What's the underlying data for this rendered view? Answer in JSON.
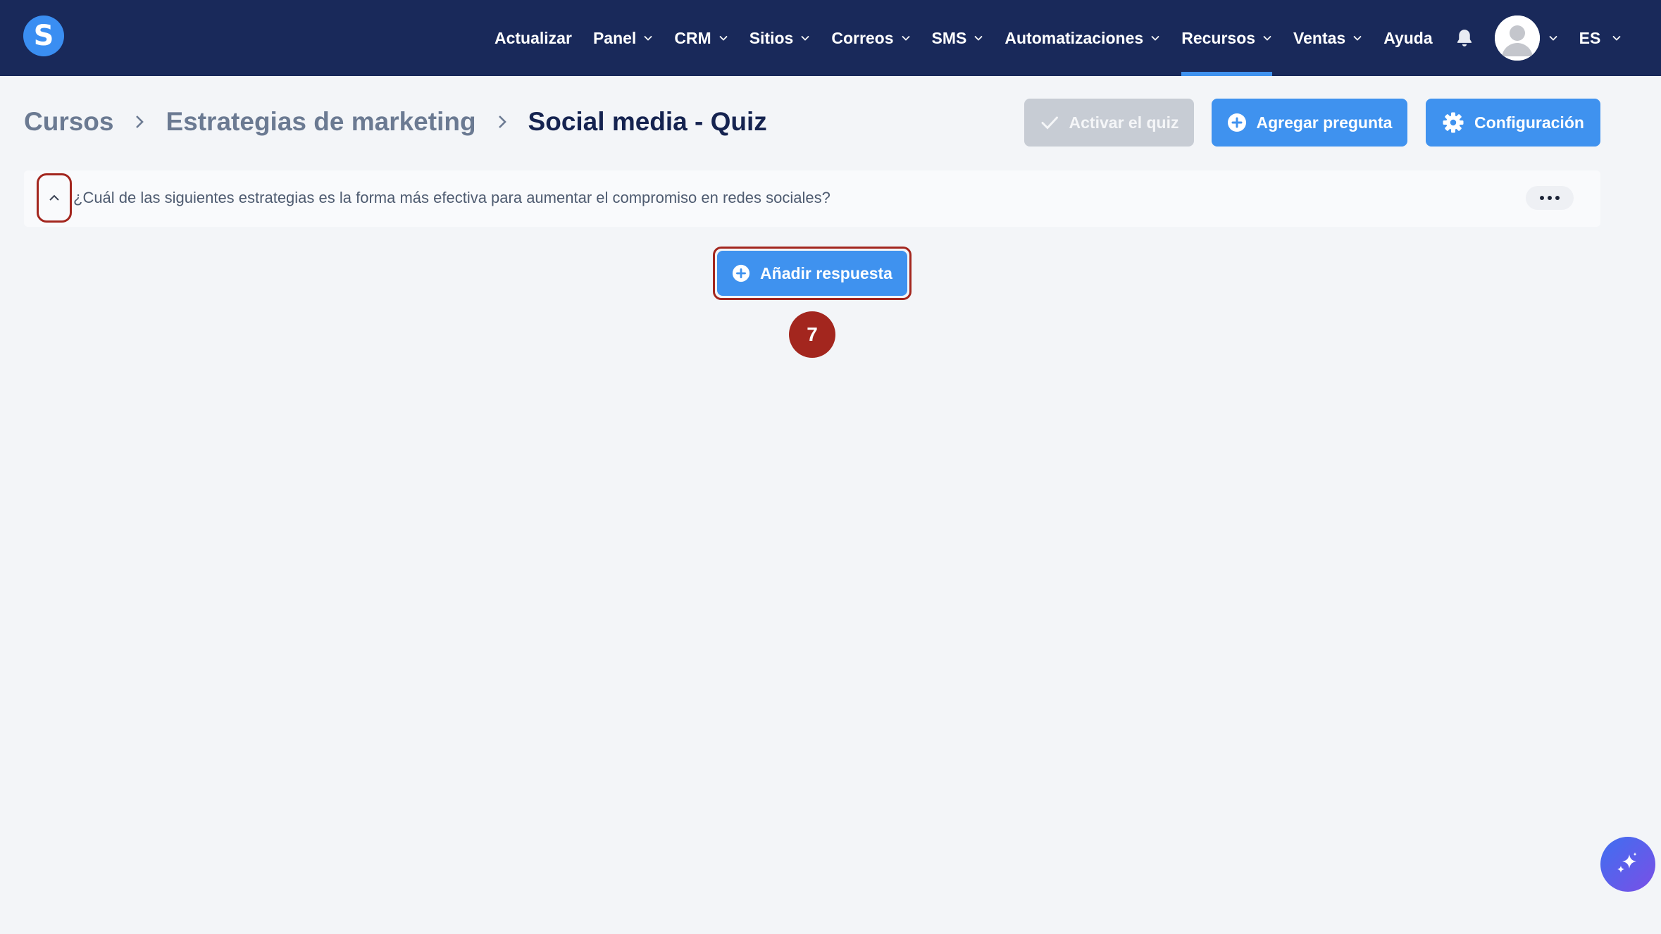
{
  "nav": {
    "items": [
      {
        "label": "Actualizar",
        "dropdown": false,
        "active": false
      },
      {
        "label": "Panel",
        "dropdown": true,
        "active": false
      },
      {
        "label": "CRM",
        "dropdown": true,
        "active": false
      },
      {
        "label": "Sitios",
        "dropdown": true,
        "active": false
      },
      {
        "label": "Correos",
        "dropdown": true,
        "active": false
      },
      {
        "label": "SMS",
        "dropdown": true,
        "active": false
      },
      {
        "label": "Automatizaciones",
        "dropdown": true,
        "active": false
      },
      {
        "label": "Recursos",
        "dropdown": true,
        "active": true
      },
      {
        "label": "Ventas",
        "dropdown": true,
        "active": false
      },
      {
        "label": "Ayuda",
        "dropdown": false,
        "active": false
      }
    ],
    "language": "ES",
    "logo_letter": "S"
  },
  "breadcrumb": {
    "items": [
      "Cursos",
      "Estrategias de marketing"
    ],
    "current": "Social media - Quiz"
  },
  "actions": {
    "activate_label": "Activar el quiz",
    "add_question_label": "Agregar pregunta",
    "settings_label": "Configuración"
  },
  "question": {
    "text": "¿Cuál de las siguientes estrategias es la forma más efectiva para aumentar el compromiso en redes sociales?"
  },
  "answer": {
    "add_label": "Añadir respuesta"
  },
  "step": {
    "number": "7"
  },
  "colors": {
    "nav_bg": "#19295a",
    "primary": "#3f92ef",
    "disabled": "#c7ccd4",
    "highlight": "#a3261e",
    "page_bg": "#f3f5f8"
  },
  "icons": {
    "logo": "logo-s-icon",
    "notifications": "bell-icon",
    "user": "user-avatar-icon",
    "activate": "check-icon",
    "add": "plus-circle-icon",
    "settings": "gear-icon",
    "collapse": "chevron-up-icon",
    "more": "more-dots-icon",
    "ai": "sparkle-icon"
  }
}
